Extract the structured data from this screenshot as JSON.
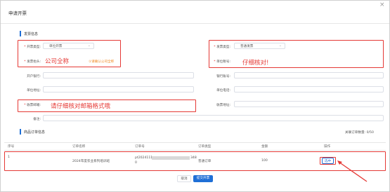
{
  "dialog": {
    "title": "申请开票"
  },
  "invoice_info": {
    "section_title": "发票信息",
    "invoice_type": {
      "label": "开票类型:",
      "value": "单位开票"
    },
    "invoice_kind": {
      "label": "发票类型:",
      "value": "普通发票"
    },
    "invoice_title": {
      "label": "发票抬头:",
      "hint": "①请确认公司全称"
    },
    "tax_number": {
      "label": "单位税号:"
    },
    "bank": {
      "label": "开户银行:"
    },
    "bank_account": {
      "label": "银行账号:"
    },
    "address": {
      "label": "单位地址:"
    },
    "phone": {
      "label": "单位电话:"
    },
    "email": {
      "label": "收票邮箱:"
    },
    "mail_address": {
      "label": "收票地址:"
    },
    "remark": {
      "label": "备注:"
    }
  },
  "annotations": {
    "company_full_name": "公司全称",
    "verify_carefully": "仔细核对!",
    "verify_email": "请仔细核对邮箱格式哦"
  },
  "orders": {
    "section_title": "商品订单信息",
    "selected_count": "关联订单数量: 0/50",
    "columns": [
      "序号",
      "订单名称",
      "订单号",
      "订单类型",
      "金额",
      "操作"
    ],
    "rows": [
      {
        "index": "1",
        "name": "2024年度农业系列培训班",
        "order_no_line1": "pt2024111",
        "order_no_line2": "0",
        "order_no_tail": "348",
        "type": "普通订单",
        "amount": "100",
        "action": "选中"
      }
    ]
  },
  "footer": {
    "cancel_label": "取消",
    "submit_label": "提交开票"
  },
  "colors": {
    "accent": "#1f6fd6",
    "annotation_red": "#e53935",
    "hint_orange": "#f08a24"
  }
}
